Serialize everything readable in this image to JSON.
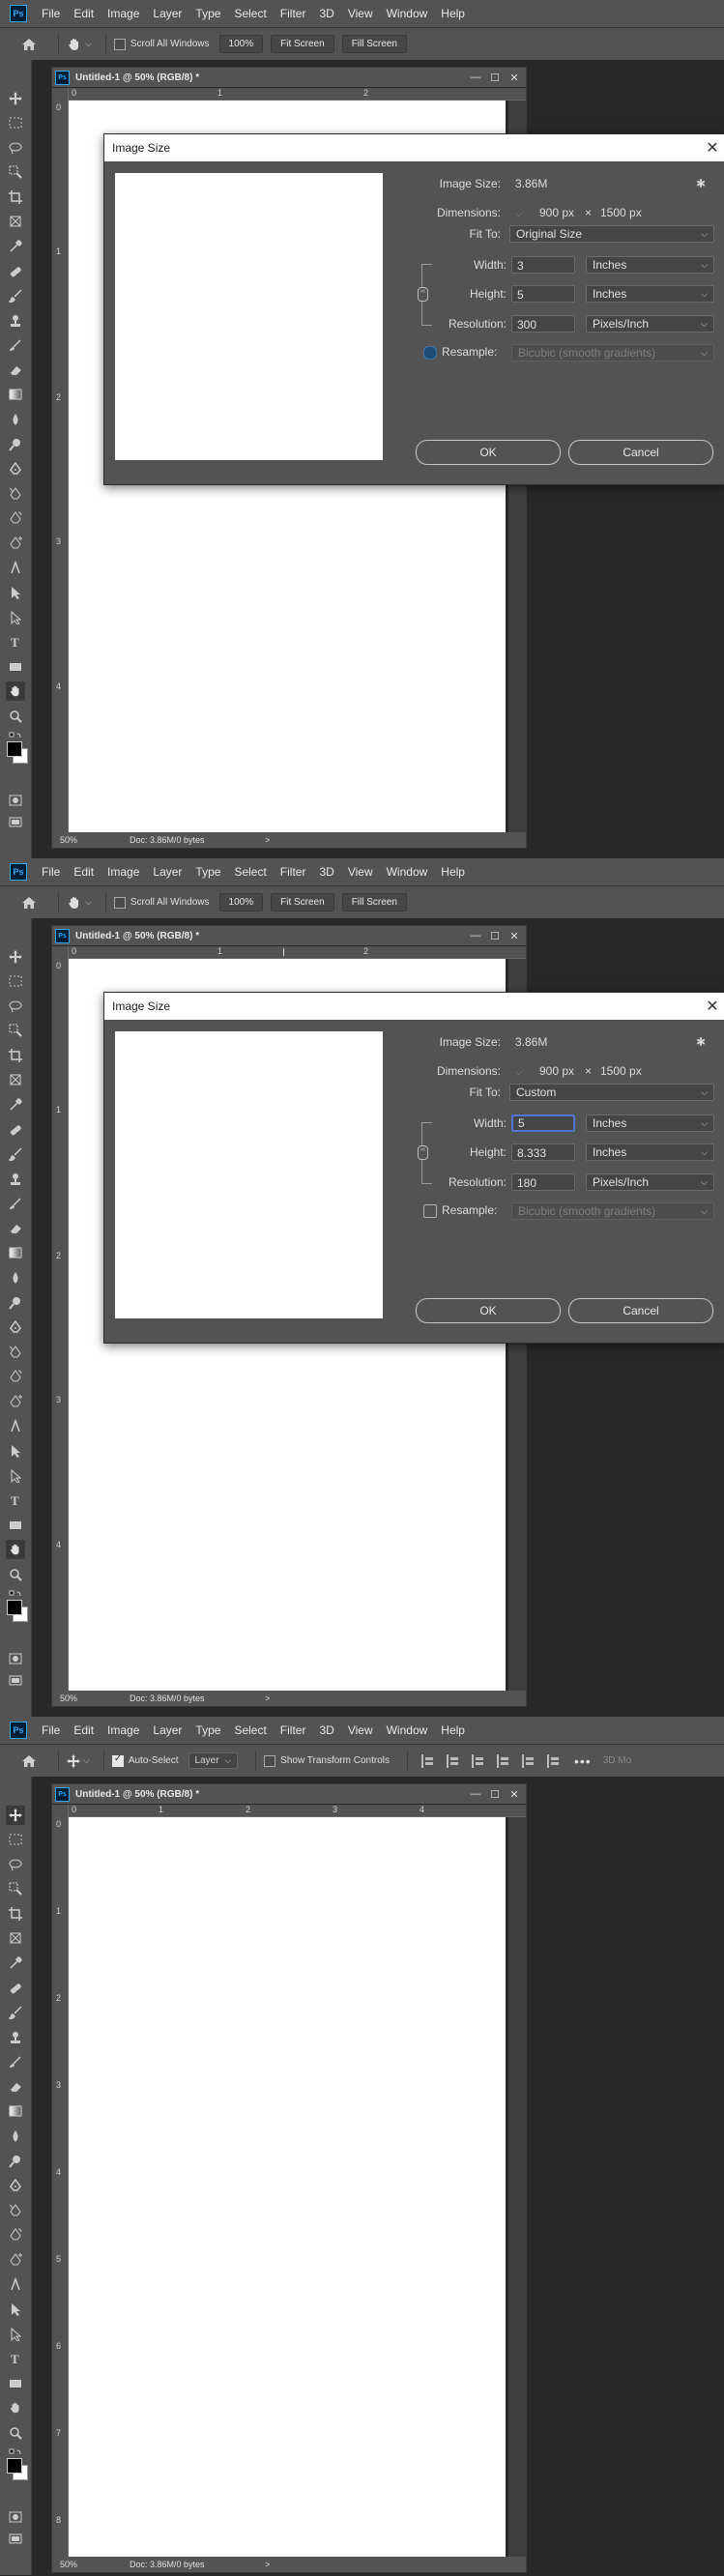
{
  "menu": [
    "File",
    "Edit",
    "Image",
    "Layer",
    "Type",
    "Select",
    "Filter",
    "3D",
    "View",
    "Window",
    "Help"
  ],
  "ps_logo": "Ps",
  "options_hand": {
    "scroll_all_windows": "Scroll All Windows",
    "zoom_100": "100%",
    "fit_screen": "Fit Screen",
    "fill_screen": "Fill Screen"
  },
  "options_move": {
    "auto_select": "Auto-Select",
    "layer_select": "Layer",
    "show_transform": "Show Transform Controls",
    "mode_3d": "3D Mo"
  },
  "document": {
    "title": "Untitled-1 @ 50% (RGB/8) *",
    "zoom": "50%",
    "doc_info": "Doc: 3.86M/0 bytes",
    "ruler_top": [
      "0",
      "1",
      "2"
    ],
    "ruler_top_full": [
      "0",
      "1",
      "2",
      "3",
      "4"
    ],
    "ruler_left": [
      "0",
      "1",
      "2",
      "3",
      "4"
    ],
    "ruler_left_full": [
      "0",
      "1",
      "2",
      "3",
      "4",
      "5",
      "6",
      "7",
      "8"
    ]
  },
  "dialog1": {
    "title": "Image Size",
    "image_size_label": "Image Size:",
    "image_size_value": "3.86M",
    "dimensions_label": "Dimensions:",
    "dimensions_w": "900 px",
    "dimensions_x": "×",
    "dimensions_h": "1500 px",
    "fit_to_label": "Fit To:",
    "fit_to_value": "Original Size",
    "width_label": "Width:",
    "width_value": "3",
    "width_unit": "Inches",
    "height_label": "Height:",
    "height_value": "5",
    "height_unit": "Inches",
    "resolution_label": "Resolution:",
    "resolution_value": "300",
    "resolution_unit": "Pixels/Inch",
    "resample_label": "Resample:",
    "resample_value": "Bicubic (smooth gradients)",
    "ok": "OK",
    "cancel": "Cancel"
  },
  "dialog2": {
    "title": "Image Size",
    "image_size_label": "Image Size:",
    "image_size_value": "3.86M",
    "dimensions_label": "Dimensions:",
    "dimensions_w": "900 px",
    "dimensions_x": "×",
    "dimensions_h": "1500 px",
    "fit_to_label": "Fit To:",
    "fit_to_value": "Custom",
    "width_label": "Width:",
    "width_value": "5",
    "width_unit": "Inches",
    "height_label": "Height:",
    "height_value": "8.333",
    "height_unit": "Inches",
    "resolution_label": "Resolution:",
    "resolution_value": "180",
    "resolution_unit": "Pixels/Inch",
    "resample_label": "Resample:",
    "resample_value": "Bicubic (smooth gradients)",
    "ok": "OK",
    "cancel": "Cancel"
  }
}
